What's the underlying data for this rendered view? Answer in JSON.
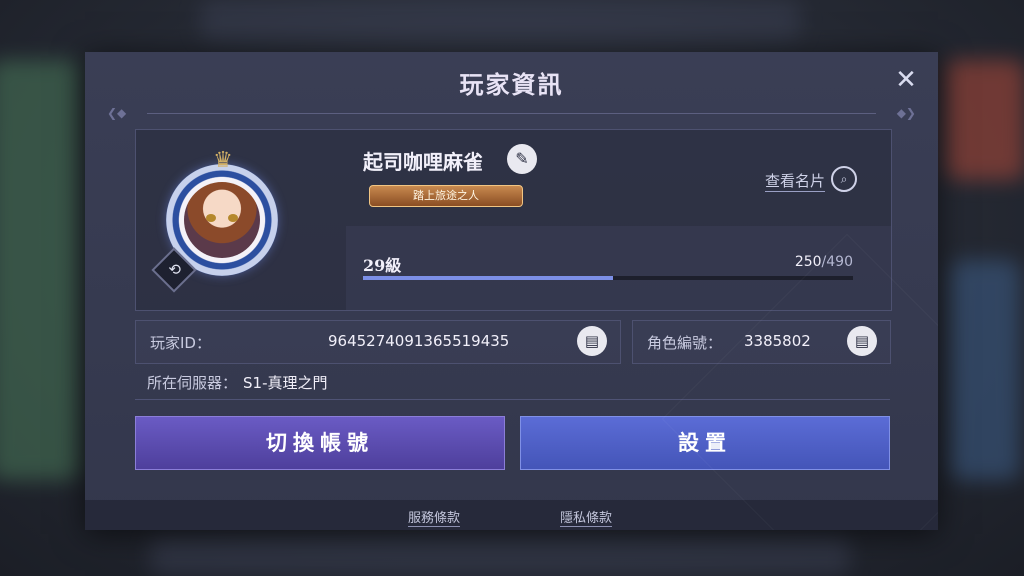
{
  "dialog": {
    "title": "玩家資訊",
    "close_icon": "close-icon"
  },
  "profile": {
    "name": "起司咖哩麻雀",
    "title_badge": "踏上旅途之人",
    "view_card_label": "查看名片",
    "level_label": "29級",
    "exp_current": "250",
    "exp_separator": "/",
    "exp_max": "490",
    "exp_fraction": 0.51
  },
  "ids": {
    "player_id_label": "玩家ID：",
    "player_id_value": "9645274091365519435",
    "character_id_label": "角色編號：",
    "character_id_value": "3385802"
  },
  "server": {
    "label": "所在伺服器：",
    "value": "S1-真理之門"
  },
  "actions": {
    "switch_account": "切換帳號",
    "settings": "設置"
  },
  "footer": {
    "terms": "服務條款",
    "privacy": "隱私條款"
  },
  "colors": {
    "accent_switch": "#5b4db3",
    "accent_settings": "#4f60c8",
    "exp_bar": "#7c8fe6",
    "badge": "#b0703c"
  }
}
